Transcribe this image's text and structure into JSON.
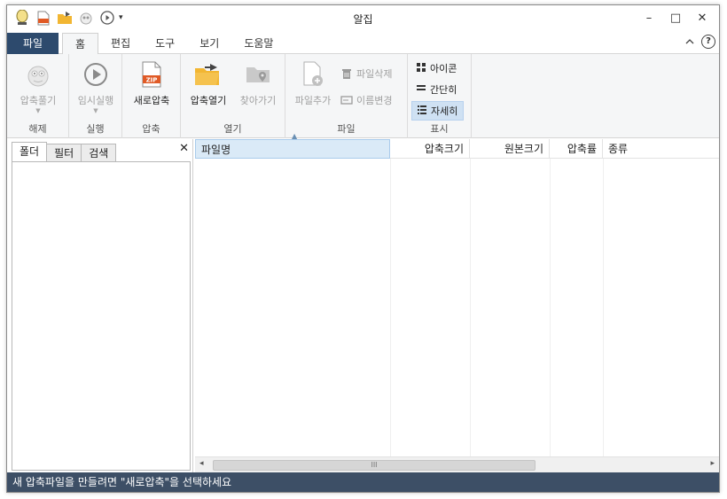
{
  "window": {
    "title": "알집"
  },
  "title_bar": {
    "quick_access": [
      "user-icon",
      "zip-file-icon",
      "open-folder-icon",
      "extract-icon",
      "play-icon"
    ],
    "controls": {
      "minimize": "–",
      "maximize": "□",
      "close": "✕"
    }
  },
  "ribbon_tabs": {
    "file": "파일",
    "items": [
      {
        "label": "홈",
        "active": true
      },
      {
        "label": "편집",
        "active": false
      },
      {
        "label": "도구",
        "active": false
      },
      {
        "label": "보기",
        "active": false
      },
      {
        "label": "도움말",
        "active": false
      }
    ],
    "help": "?"
  },
  "ribbon": {
    "groups": {
      "extract": {
        "label": "해제",
        "button": "압축풀기"
      },
      "run": {
        "label": "실행",
        "button": "임시실행"
      },
      "compress": {
        "label": "압축",
        "button": "새로압축"
      },
      "open": {
        "label": "열기",
        "open_button": "압축열기",
        "find_button": "찾아가기"
      },
      "file": {
        "label": "파일",
        "add_button": "파일추가",
        "delete_button": "파일삭제",
        "rename_button": "이름변경"
      },
      "view": {
        "label": "표시",
        "icons": "아이콘",
        "simple": "간단히",
        "detail": "자세히",
        "selected": "자세히"
      }
    }
  },
  "left_panel": {
    "tabs": [
      "폴더",
      "필터",
      "검색"
    ],
    "active_tab": "폴더",
    "close": "✕"
  },
  "file_list": {
    "columns": [
      "파일명",
      "압축크기",
      "원본크기",
      "압축률",
      "종류"
    ],
    "sorted_column": "파일명",
    "rows": []
  },
  "status_bar": {
    "text": "새 압축파일을 만들려면 \"새로압축\"을 선택하세요"
  },
  "colors": {
    "file_tab": "#2d4a6d",
    "status_bar": "#3d4f66",
    "selection": "#cfe1f3",
    "accent_orange": "#e05a26",
    "folder_yellow": "#f2b632"
  }
}
